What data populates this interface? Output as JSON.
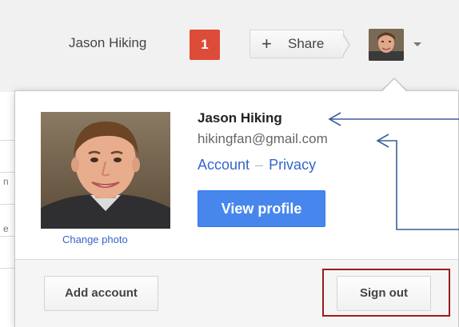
{
  "header": {
    "user_name": "Jason Hiking",
    "notification_count": "1",
    "share_label": "Share",
    "share_icon": "plus-icon",
    "avatar_icon": "avatar",
    "menu_icon": "chevron-down-icon"
  },
  "account_card": {
    "name": "Jason Hiking",
    "email": "hikingfan@gmail.com",
    "account_link": "Account",
    "separator": "–",
    "privacy_link": "Privacy",
    "view_profile_label": "View profile",
    "change_photo_label": "Change photo"
  },
  "footer": {
    "add_account_label": "Add account",
    "sign_out_label": "Sign out"
  },
  "background_page": {
    "fragments": [
      "n",
      "e"
    ]
  },
  "colors": {
    "notification": "#dd4b39",
    "primary_button": "#4787ed",
    "link": "#3366cc",
    "annotation_arrow": "#3b5f9a",
    "highlight_box": "#9b1c1c"
  }
}
